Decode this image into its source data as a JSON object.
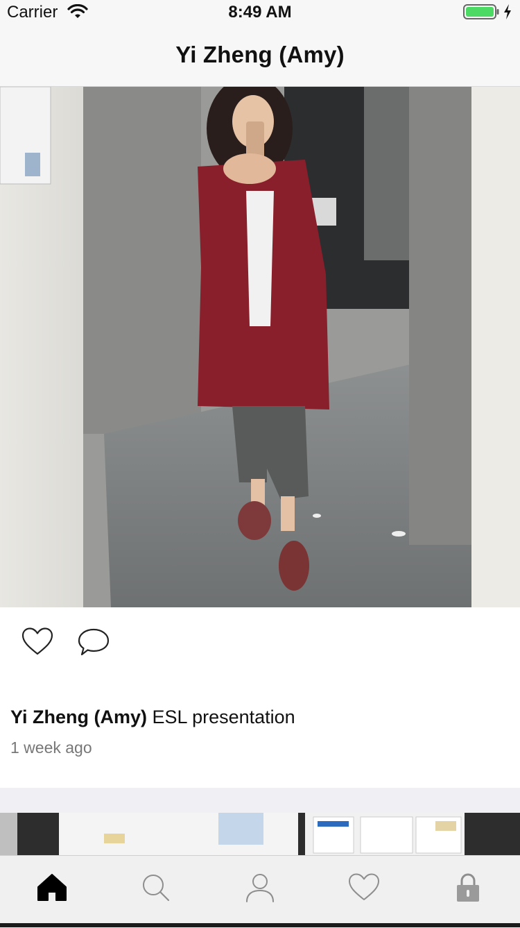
{
  "status_bar": {
    "carrier": "Carrier",
    "time": "8:49 AM",
    "wifi_icon": "wifi-icon",
    "battery_icon": "battery-charging-icon"
  },
  "nav": {
    "title": "Yi Zheng (Amy)"
  },
  "post": {
    "photo_icon": "photo",
    "actions": {
      "like_icon": "heart-outline-icon",
      "comment_icon": "comment-bubble-icon"
    },
    "caption_author": "Yi Zheng (Amy)",
    "caption_text": "ESL presentation",
    "timestamp": "1 week ago"
  },
  "next_post": {
    "photo_icon": "photo"
  },
  "tab_bar": {
    "tabs": [
      {
        "icon": "home-icon",
        "active": true
      },
      {
        "icon": "search-icon",
        "active": false
      },
      {
        "icon": "profile-icon",
        "active": false
      },
      {
        "icon": "heart-icon",
        "active": false
      },
      {
        "icon": "lock-icon",
        "active": false
      }
    ]
  },
  "colors": {
    "nav_background": "#f7f7f7",
    "separator": "#efeff4",
    "tab_active": "#000000",
    "tab_inactive": "#8e8e8e",
    "battery_fill": "#4cd964",
    "coat": "#8a1f2c"
  }
}
